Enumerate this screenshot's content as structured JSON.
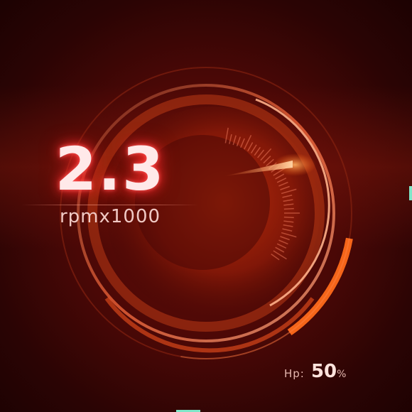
{
  "gauge": {
    "value": "2.3",
    "unit": "rpmx1000",
    "needle_fraction": 0.23
  },
  "hp": {
    "label": "Hp:",
    "value": "50",
    "unit": "%",
    "level": 0.5
  },
  "colors": {
    "background": "#2a0404",
    "accent": "#ff6a1a",
    "arc_highlight": "#ffb070",
    "readout_glow": "#ff2a2a",
    "marker": "#7fe6c8"
  }
}
